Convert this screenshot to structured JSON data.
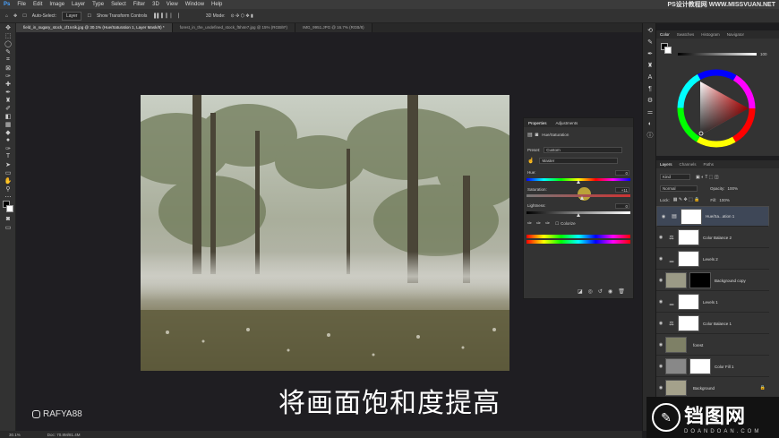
{
  "menu": [
    "Ps",
    "File",
    "Edit",
    "Image",
    "Layer",
    "Type",
    "Select",
    "Filter",
    "3D",
    "View",
    "Window",
    "Help"
  ],
  "watermark_top": "PS设计教程网 WWW.MISSVUAN.NET",
  "options": {
    "auto_select": "Auto-Select:",
    "layer": "Layer",
    "show_transform": "Show Transform Controls",
    "mode_3d": "3D Mode:"
  },
  "tabs": [
    {
      "label": "field_in_sugary_stock_cf1n4ik.jpg @ 30.1% (Hue/Saturation 1, Layer Mask/8) *",
      "active": true
    },
    {
      "label": "forest_in_the_undefined_stock_f5h4e7.jpg @ 15% (RGB/8*)",
      "active": false
    },
    {
      "label": "IMG_9951.JPG @ 16.7% (RGB/8)",
      "active": false
    }
  ],
  "properties": {
    "tabs": [
      "Properties",
      "Adjustments"
    ],
    "title": "Hue/Saturation",
    "preset_label": "Preset:",
    "preset_value": "Custom",
    "channel_value": "Master",
    "hue_label": "Hue:",
    "hue_value": "0",
    "saturation_label": "Saturation:",
    "saturation_value": "+11",
    "lightness_label": "Lightness:",
    "lightness_value": "0",
    "colorize_label": "Colorize"
  },
  "color_panel": {
    "tabs": [
      "Color",
      "Swatches",
      "Histogram",
      "Navigator"
    ],
    "value": "100"
  },
  "layers_panel": {
    "tabs": [
      "Layers",
      "Channels",
      "Paths"
    ],
    "kind": "Kind",
    "blend": "Normal",
    "opacity_label": "Opacity:",
    "opacity": "100%",
    "lock_label": "Lock:",
    "fill_label": "Fill:",
    "fill": "100%",
    "layers": [
      {
        "name": "Hue/Sa...ation 1",
        "icon": "▤",
        "selected": true
      },
      {
        "name": "Color Balance 2",
        "icon": "⚖",
        "selected": false
      },
      {
        "name": "Levels 2",
        "icon": "▁",
        "selected": false
      },
      {
        "name": "Background copy",
        "icon": "",
        "selected": false
      },
      {
        "name": "Levels 1",
        "icon": "▁",
        "selected": false
      },
      {
        "name": "Color Balance 1",
        "icon": "⚖",
        "selected": false
      },
      {
        "name": "forest",
        "icon": "",
        "selected": false
      },
      {
        "name": "Color Fill 1",
        "icon": "",
        "selected": false
      },
      {
        "name": "Background",
        "icon": "",
        "selected": false
      }
    ]
  },
  "status": {
    "zoom": "30.1%",
    "doc": "Doc: 70.8M/81.4M"
  },
  "subtitle": "将画面饱和度提高",
  "handle": "RAFYA88",
  "logo": {
    "big": "铛图网",
    "small": "DOANDOAN.COM"
  },
  "saturation_fraction": 0.54
}
